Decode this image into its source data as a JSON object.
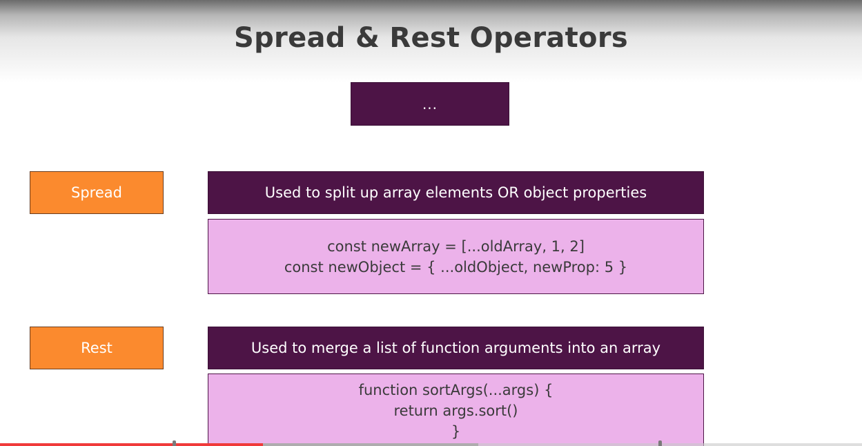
{
  "slide": {
    "title": "Spread & Rest Operators",
    "operator_symbol": "...",
    "rows": [
      {
        "label": "Spread",
        "description": "Used to split up array elements OR object properties",
        "code_lines": [
          "const newArray = [...oldArray, 1, 2]",
          "const newObject = { ...oldObject, newProp: 5 }"
        ]
      },
      {
        "label": "Rest",
        "description": "Used to merge a list of function arguments into an array",
        "code_lines": [
          "function sortArgs(...args) {",
          "return args.sort()",
          "}"
        ]
      }
    ]
  },
  "player": {
    "progress": 0.305,
    "buffered": 0.555
  },
  "colors": {
    "dark_purple": "#4d1446",
    "light_pink": "#ecb2ea",
    "orange": "#fb8a2e",
    "progress_red": "#f03a3a"
  }
}
